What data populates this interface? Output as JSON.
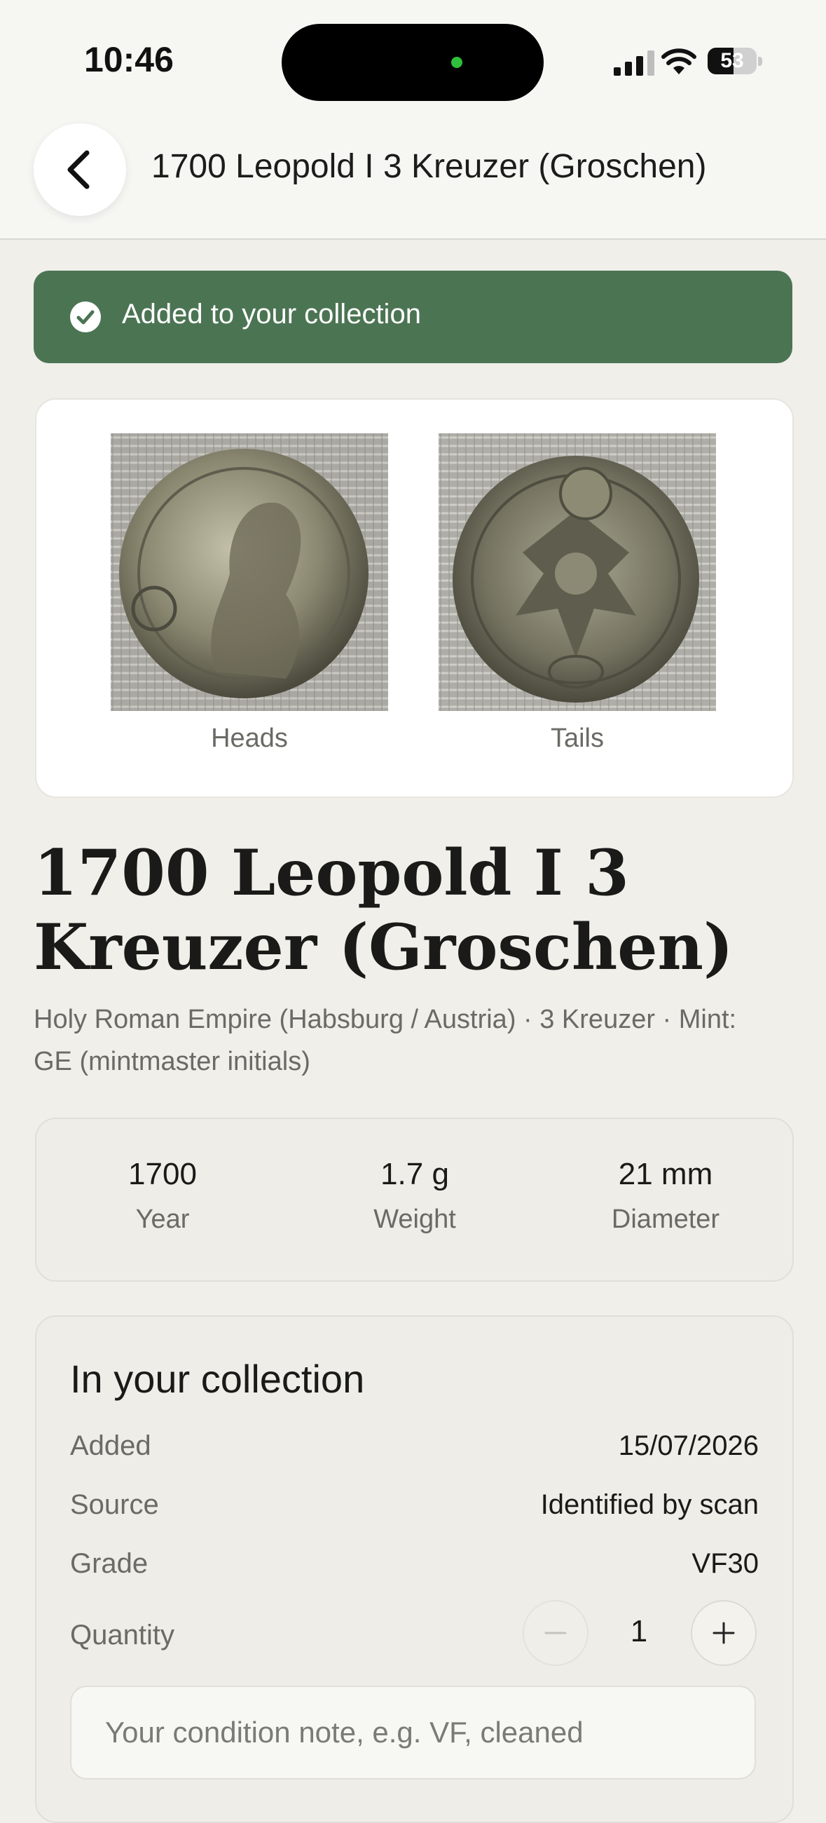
{
  "status_bar": {
    "time": "10:46",
    "battery": "53",
    "battery_level": 0.53
  },
  "nav": {
    "title": "1700 Leopold I 3 Kreuzer (Groschen)",
    "back_icon": "chevron-left-icon"
  },
  "toast": {
    "text": "Added to your collection",
    "icon": "check-circle-icon",
    "color": "#4b7453"
  },
  "images": {
    "heads_label": "Heads",
    "tails_label": "Tails"
  },
  "coin": {
    "title": "1700 Leopold I 3 Kreuzer (Groschen)",
    "subtitle": "Holy Roman Empire (Habsburg / Austria) · 3 Kreuzer · Mint: GE (mintmaster initials)"
  },
  "stats": [
    {
      "value": "1700",
      "label": "Year"
    },
    {
      "value": "1.7 g",
      "label": "Weight"
    },
    {
      "value": "21 mm",
      "label": "Diameter"
    }
  ],
  "collection": {
    "title": "In your collection",
    "rows": [
      {
        "label": "Added",
        "value": "15/07/2026"
      },
      {
        "label": "Source",
        "value": "Identified by scan"
      },
      {
        "label": "Grade",
        "value": "VF30"
      }
    ],
    "quantity_label": "Quantity",
    "quantity": "1",
    "note_placeholder": "Your condition note, e.g. VF, cleaned",
    "note_value": ""
  }
}
